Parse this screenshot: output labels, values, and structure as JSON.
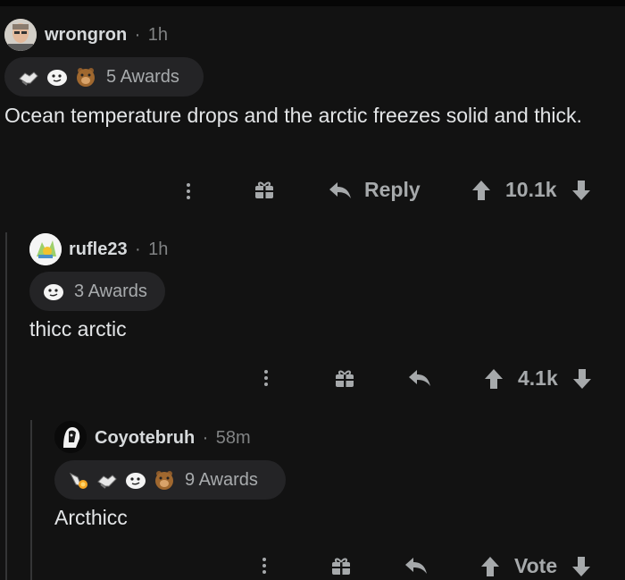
{
  "comments": [
    {
      "username": "wrongron",
      "separator": "·",
      "time": "1h",
      "awards_label": "5 Awards",
      "awards": [
        "handshake-award-icon",
        "doge-face-award-icon",
        "bear-award-icon"
      ],
      "text": "Ocean temperature drops and the arctic freezes solid and thick.",
      "reply_label": "Reply",
      "score": "10.1k"
    },
    {
      "username": "rufle23",
      "separator": "·",
      "time": "1h",
      "awards_label": "3 Awards",
      "awards": [
        "doge-face-award-icon"
      ],
      "text": "thicc arctic",
      "score": "4.1k"
    },
    {
      "username": "Coyotebruh",
      "separator": "·",
      "time": "58m",
      "awards_label": "9 Awards",
      "awards": [
        "rocket-like-award-icon",
        "handshake-award-icon",
        "doge-face-award-icon",
        "bear-award-icon"
      ],
      "text": "Arcthicc",
      "score": "Vote"
    }
  ],
  "colors": {
    "background": "#121212",
    "text": "#d7dadc",
    "muted": "#818384",
    "pill": "#242426",
    "thread_line": "#343536"
  }
}
